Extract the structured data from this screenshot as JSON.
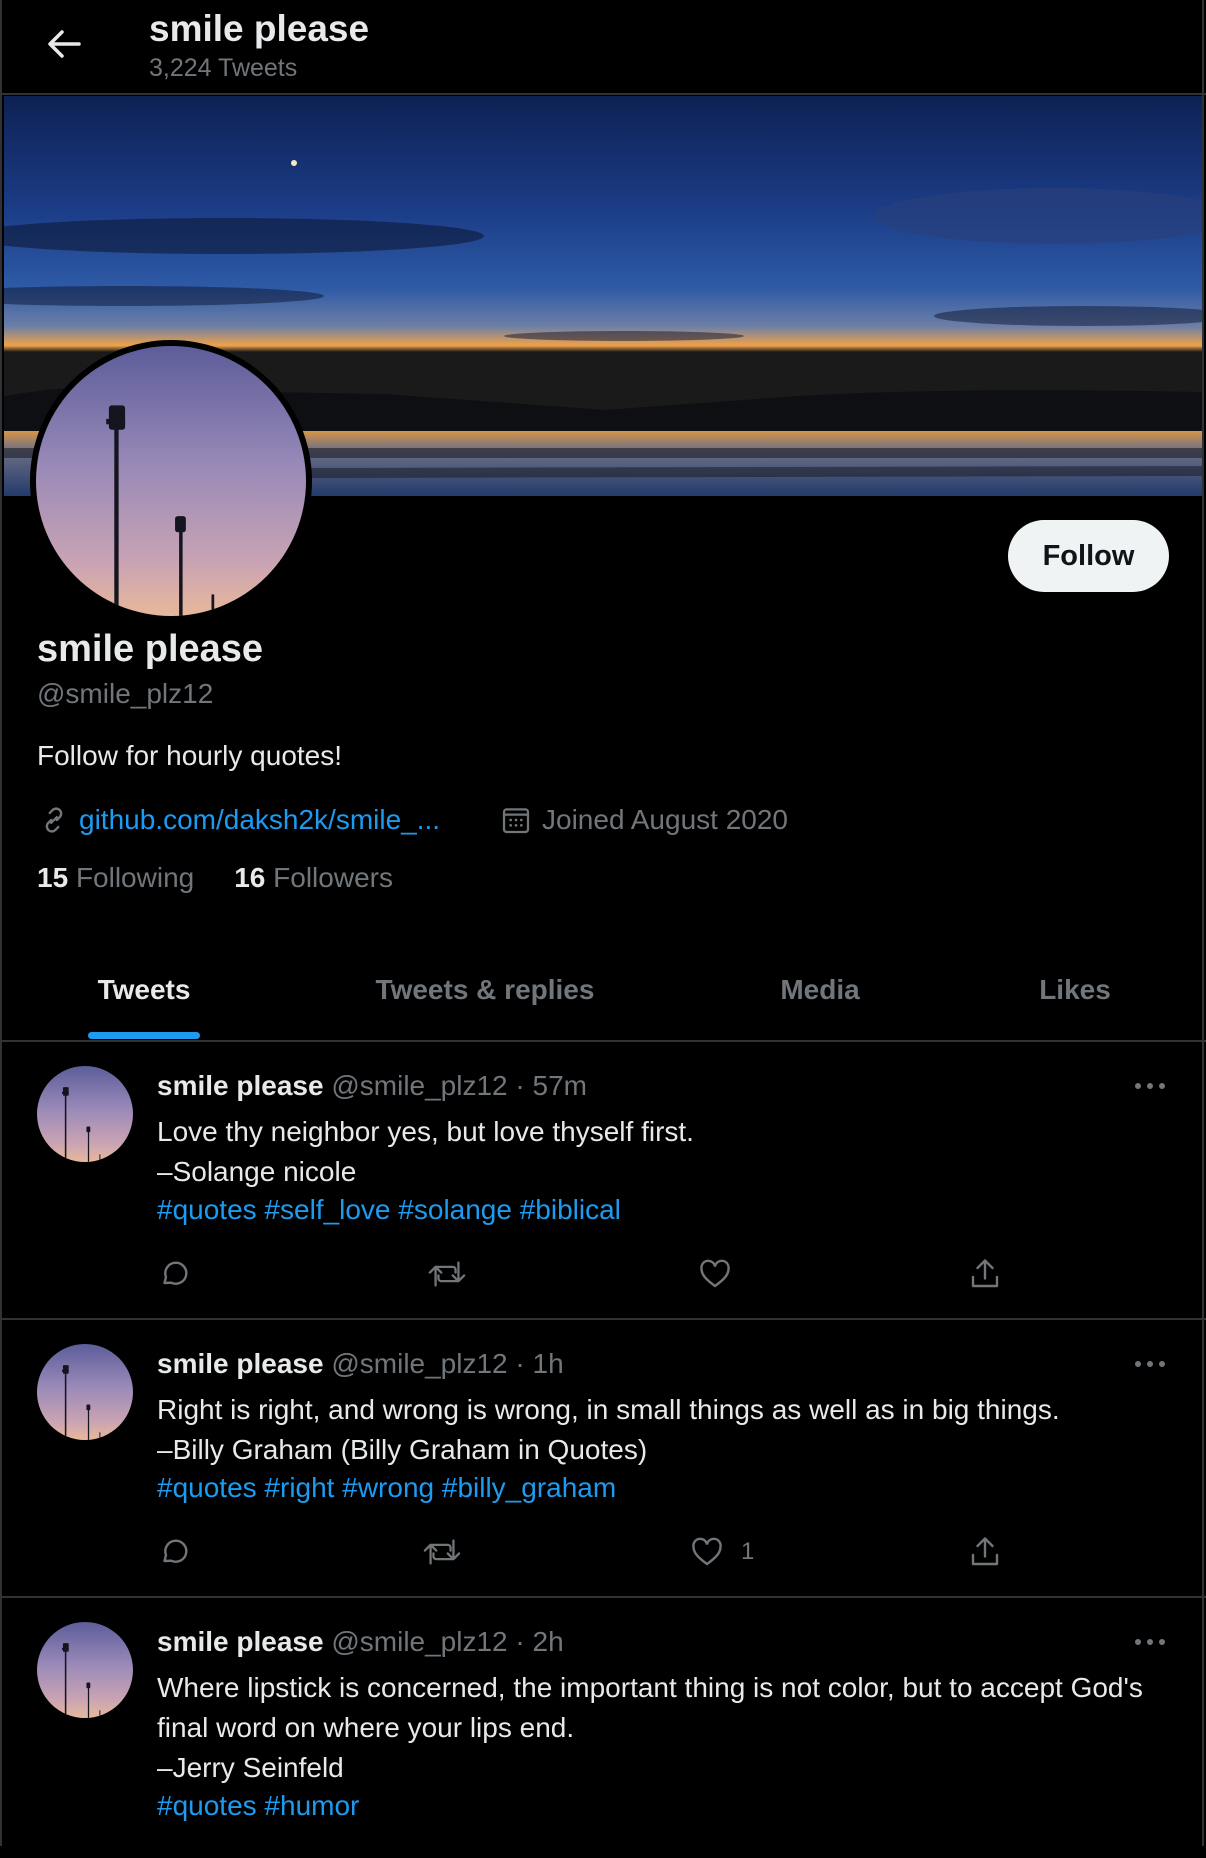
{
  "header": {
    "title": "smile please",
    "tweet_count": "3,224 Tweets"
  },
  "profile": {
    "name": "smile please",
    "handle": "@smile_plz12",
    "bio": "Follow for hourly quotes!",
    "link": "github.com/daksh2k/smile_...",
    "joined": "Joined August 2020",
    "following_count": "15",
    "following_label": "Following",
    "followers_count": "16",
    "followers_label": "Followers",
    "follow_button": "Follow"
  },
  "tabs": [
    {
      "label": "Tweets",
      "active": true
    },
    {
      "label": "Tweets & replies",
      "active": false
    },
    {
      "label": "Media",
      "active": false
    },
    {
      "label": "Likes",
      "active": false
    }
  ],
  "tweets": [
    {
      "name": "smile please",
      "meta": "@smile_plz12 · 57m",
      "lines": [
        "Love thy neighbor yes, but love thyself first.",
        "–Solange nicole"
      ],
      "tags": [
        "#quotes",
        "#self_love",
        "#solange",
        "#biblical"
      ],
      "like_count": ""
    },
    {
      "name": "smile please",
      "meta": "@smile_plz12 · 1h",
      "lines": [
        "Right is right, and wrong is wrong, in small things as well as in big things.",
        "–Billy Graham (Billy Graham in Quotes)"
      ],
      "tags": [
        "#quotes",
        "#right",
        "#wrong",
        "#billy_graham"
      ],
      "like_count": "1"
    },
    {
      "name": "smile please",
      "meta": "@smile_plz12 · 2h",
      "lines": [
        "Where lipstick is concerned, the important thing is not color, but to accept God's final word on where your lips end.",
        "–Jerry Seinfeld"
      ],
      "tags": [
        "#quotes",
        "#humor"
      ],
      "like_count": ""
    }
  ],
  "icons": {
    "back": "arrow-left-icon",
    "link": "link-icon",
    "calendar": "calendar-icon",
    "more": "more-icon",
    "reply": "reply-icon",
    "retweet": "retweet-icon",
    "like": "heart-icon",
    "share": "share-icon"
  },
  "colors": {
    "background": "#000000",
    "accent": "#1d9bf0",
    "text": "#e7e9ea",
    "muted": "#71767b",
    "border": "#2f3336"
  }
}
